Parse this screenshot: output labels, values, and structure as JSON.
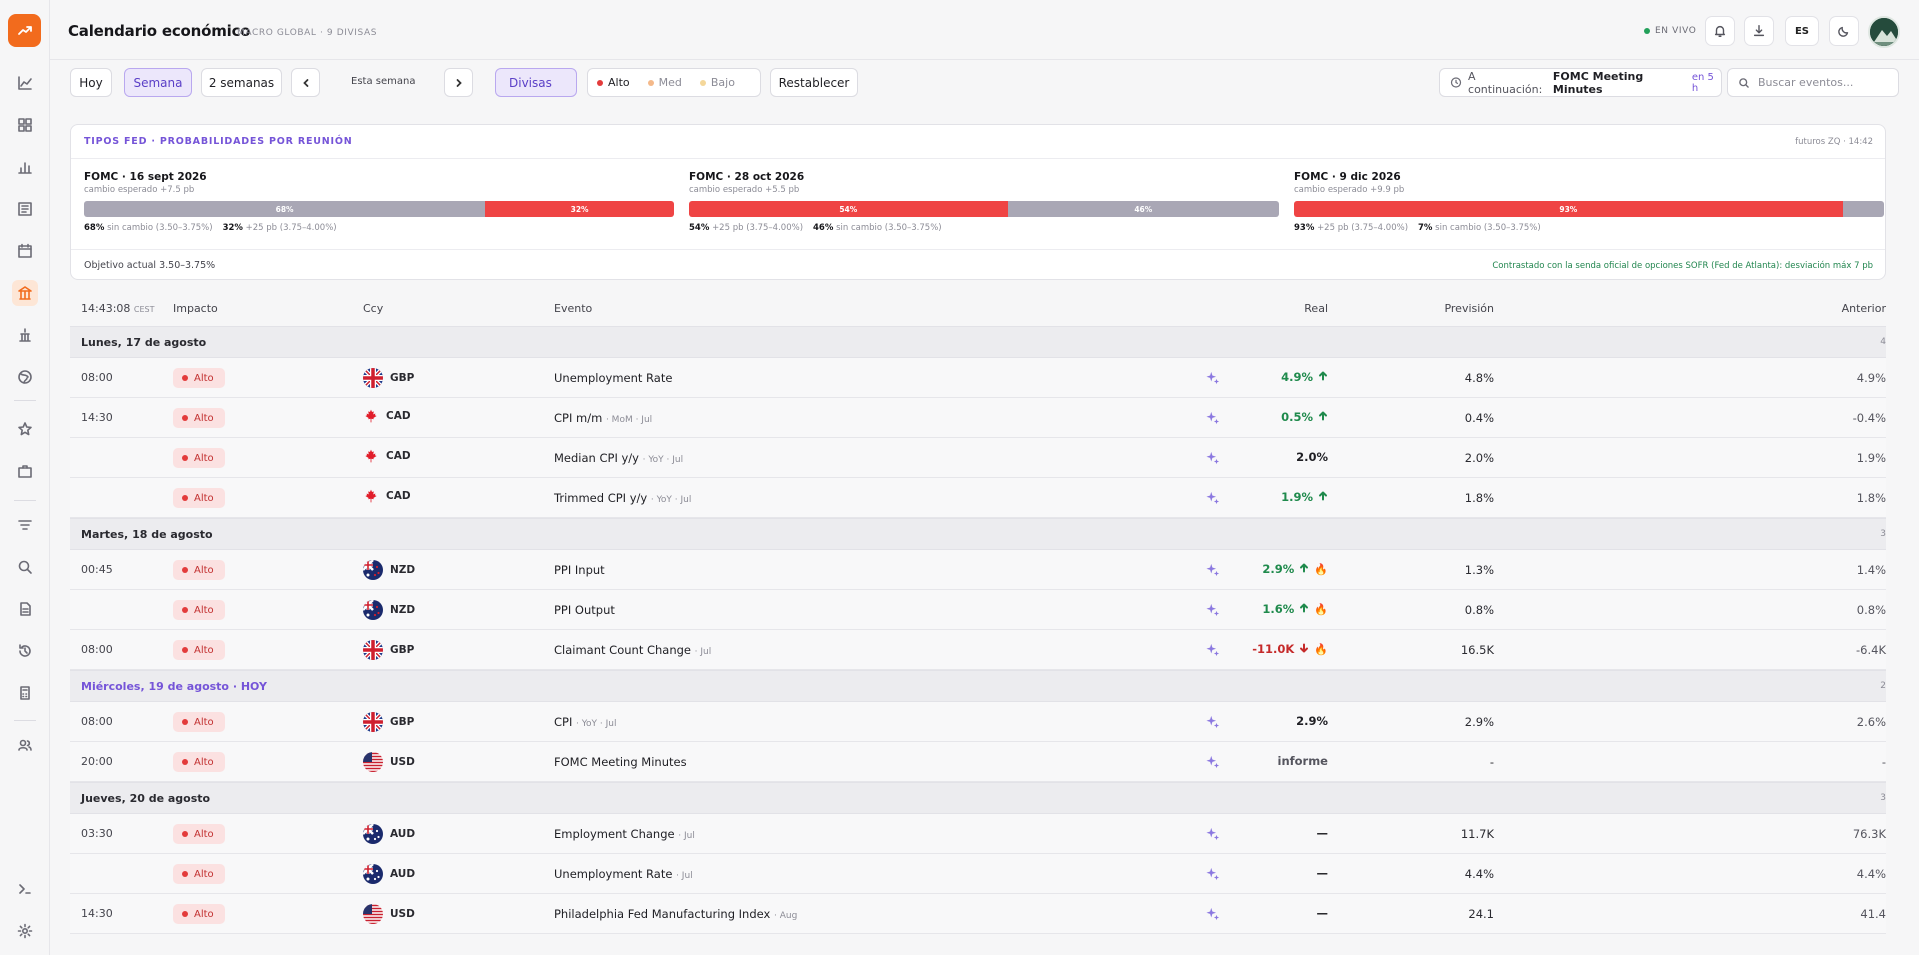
{
  "app": {
    "title": "Calendario económico",
    "subtitle": "MACRO GLOBAL · 9 DIVISAS",
    "live_label": "EN VIVO",
    "lang": "ES"
  },
  "toolbar": {
    "today": "Hoy",
    "week": "Semana",
    "two_weeks": "2 semanas",
    "week_label": "Esta semana",
    "currencies": "Divisas",
    "impact_high": "Alto",
    "impact_med": "Med",
    "impact_low": "Bajo",
    "reset": "Restablecer",
    "next_prefix": "A continuación:",
    "next_event": "FOMC Meeting Minutes",
    "next_time": "en 5 h",
    "search_placeholder": "Buscar eventos..."
  },
  "fed": {
    "title": "TIPOS FED · PROBABILIDADES POR REUNIÓN",
    "source": "futuros ZQ · 14:42",
    "target": "Objetivo actual 3.50–3.75%",
    "note": "Contrastado con la senda oficial de opciones SOFR (Fed de Atlanta): desviación máx 7 pb",
    "meetings": [
      {
        "title": "FOMC · 16 sept 2026",
        "sub": "cambio esperado +7.5 pb",
        "segments": [
          {
            "pct": 68,
            "label": "68%",
            "kind": "gray"
          },
          {
            "pct": 32,
            "label": "32%",
            "kind": "red"
          }
        ],
        "legend": [
          {
            "val": "68%",
            "txt": "sin cambio (3.50–3.75%)"
          },
          {
            "val": "32%",
            "txt": "+25 pb (3.75–4.00%)"
          }
        ]
      },
      {
        "title": "FOMC · 28 oct 2026",
        "sub": "cambio esperado +5.5 pb",
        "segments": [
          {
            "pct": 54,
            "label": "54%",
            "kind": "red"
          },
          {
            "pct": 46,
            "label": "46%",
            "kind": "gray"
          }
        ],
        "legend": [
          {
            "val": "54%",
            "txt": "+25 pb (3.75–4.00%)"
          },
          {
            "val": "46%",
            "txt": "sin cambio (3.50–3.75%)"
          }
        ]
      },
      {
        "title": "FOMC · 9 dic 2026",
        "sub": "cambio esperado +9.9 pb",
        "segments": [
          {
            "pct": 93,
            "label": "93%",
            "kind": "red"
          },
          {
            "pct": 7,
            "label": "",
            "kind": "gray"
          }
        ],
        "legend": [
          {
            "val": "93%",
            "txt": "+25 pb (3.75–4.00%)"
          },
          {
            "val": "7%",
            "txt": "sin cambio (3.50–3.75%)"
          }
        ]
      }
    ]
  },
  "table": {
    "clock": "14:43:08",
    "tz": "CEST",
    "headers": {
      "impact": "Impacto",
      "ccy": "Ccy",
      "event": "Evento",
      "actual": "Real",
      "forecast": "Previsión",
      "previous": "Anterior"
    },
    "days": [
      {
        "label": "Lunes, 17 de agosto",
        "count": "4",
        "today": false,
        "rows": [
          {
            "time": "08:00",
            "impact": "Alto",
            "ccy": "GBP",
            "flag": "gb",
            "event": "Unemployment Rate",
            "meta": "",
            "actual": "4.9%",
            "dir": "up",
            "fire": false,
            "forecast": "4.8%",
            "previous": "4.9%"
          },
          {
            "time": "14:30",
            "impact": "Alto",
            "ccy": "CAD",
            "flag": "ca",
            "event": "CPI m/m",
            "meta": "· MoM · Jul",
            "actual": "0.5%",
            "dir": "up",
            "fire": false,
            "forecast": "0.4%",
            "previous": "-0.4%"
          },
          {
            "time": "",
            "impact": "Alto",
            "ccy": "CAD",
            "flag": "ca",
            "event": "Median CPI y/y",
            "meta": "· YoY · Jul",
            "actual": "2.0%",
            "dir": "neutral",
            "fire": false,
            "forecast": "2.0%",
            "previous": "1.9%"
          },
          {
            "time": "",
            "impact": "Alto",
            "ccy": "CAD",
            "flag": "ca",
            "event": "Trimmed CPI y/y",
            "meta": "· YoY · Jul",
            "actual": "1.9%",
            "dir": "up",
            "fire": false,
            "forecast": "1.8%",
            "previous": "1.8%"
          }
        ]
      },
      {
        "label": "Martes, 18 de agosto",
        "count": "3",
        "today": false,
        "rows": [
          {
            "time": "00:45",
            "impact": "Alto",
            "ccy": "NZD",
            "flag": "nz",
            "event": "PPI Input",
            "meta": "",
            "actual": "2.9%",
            "dir": "up",
            "fire": true,
            "forecast": "1.3%",
            "previous": "1.4%"
          },
          {
            "time": "",
            "impact": "Alto",
            "ccy": "NZD",
            "flag": "nz",
            "event": "PPI Output",
            "meta": "",
            "actual": "1.6%",
            "dir": "up",
            "fire": true,
            "forecast": "0.8%",
            "previous": "0.8%"
          },
          {
            "time": "08:00",
            "impact": "Alto",
            "ccy": "GBP",
            "flag": "gb",
            "event": "Claimant Count Change",
            "meta": "· Jul",
            "actual": "-11.0K",
            "dir": "down",
            "fire": true,
            "forecast": "16.5K",
            "previous": "-6.4K"
          }
        ]
      },
      {
        "label": "Miércoles, 19 de agosto · HOY",
        "count": "2",
        "today": true,
        "rows": [
          {
            "time": "08:00",
            "impact": "Alto",
            "ccy": "GBP",
            "flag": "gb",
            "event": "CPI",
            "meta": "· YoY · Jul",
            "actual": "2.9%",
            "dir": "neutral",
            "fire": false,
            "forecast": "2.9%",
            "previous": "2.6%"
          },
          {
            "time": "20:00",
            "impact": "Alto",
            "ccy": "USD",
            "flag": "us",
            "event": "FOMC Meeting Minutes",
            "meta": "",
            "actual": "informe",
            "dir": "muted",
            "fire": false,
            "forecast": "-",
            "previous": "-"
          }
        ]
      },
      {
        "label": "Jueves, 20 de agosto",
        "count": "3",
        "today": false,
        "rows": [
          {
            "time": "03:30",
            "impact": "Alto",
            "ccy": "AUD",
            "flag": "au",
            "event": "Employment Change",
            "meta": "· Jul",
            "actual": "—",
            "dir": "neutral",
            "fire": false,
            "forecast": "11.7K",
            "previous": "76.3K"
          },
          {
            "time": "",
            "impact": "Alto",
            "ccy": "AUD",
            "flag": "au",
            "event": "Unemployment Rate",
            "meta": "· Jul",
            "actual": "—",
            "dir": "neutral",
            "fire": false,
            "forecast": "4.4%",
            "previous": "4.4%"
          },
          {
            "time": "14:30",
            "impact": "Alto",
            "ccy": "USD",
            "flag": "us",
            "event": "Philadelphia Fed Manufacturing Index",
            "meta": "· Aug",
            "actual": "—",
            "dir": "neutral",
            "fire": false,
            "forecast": "24.1",
            "previous": "41.4"
          }
        ]
      }
    ]
  }
}
